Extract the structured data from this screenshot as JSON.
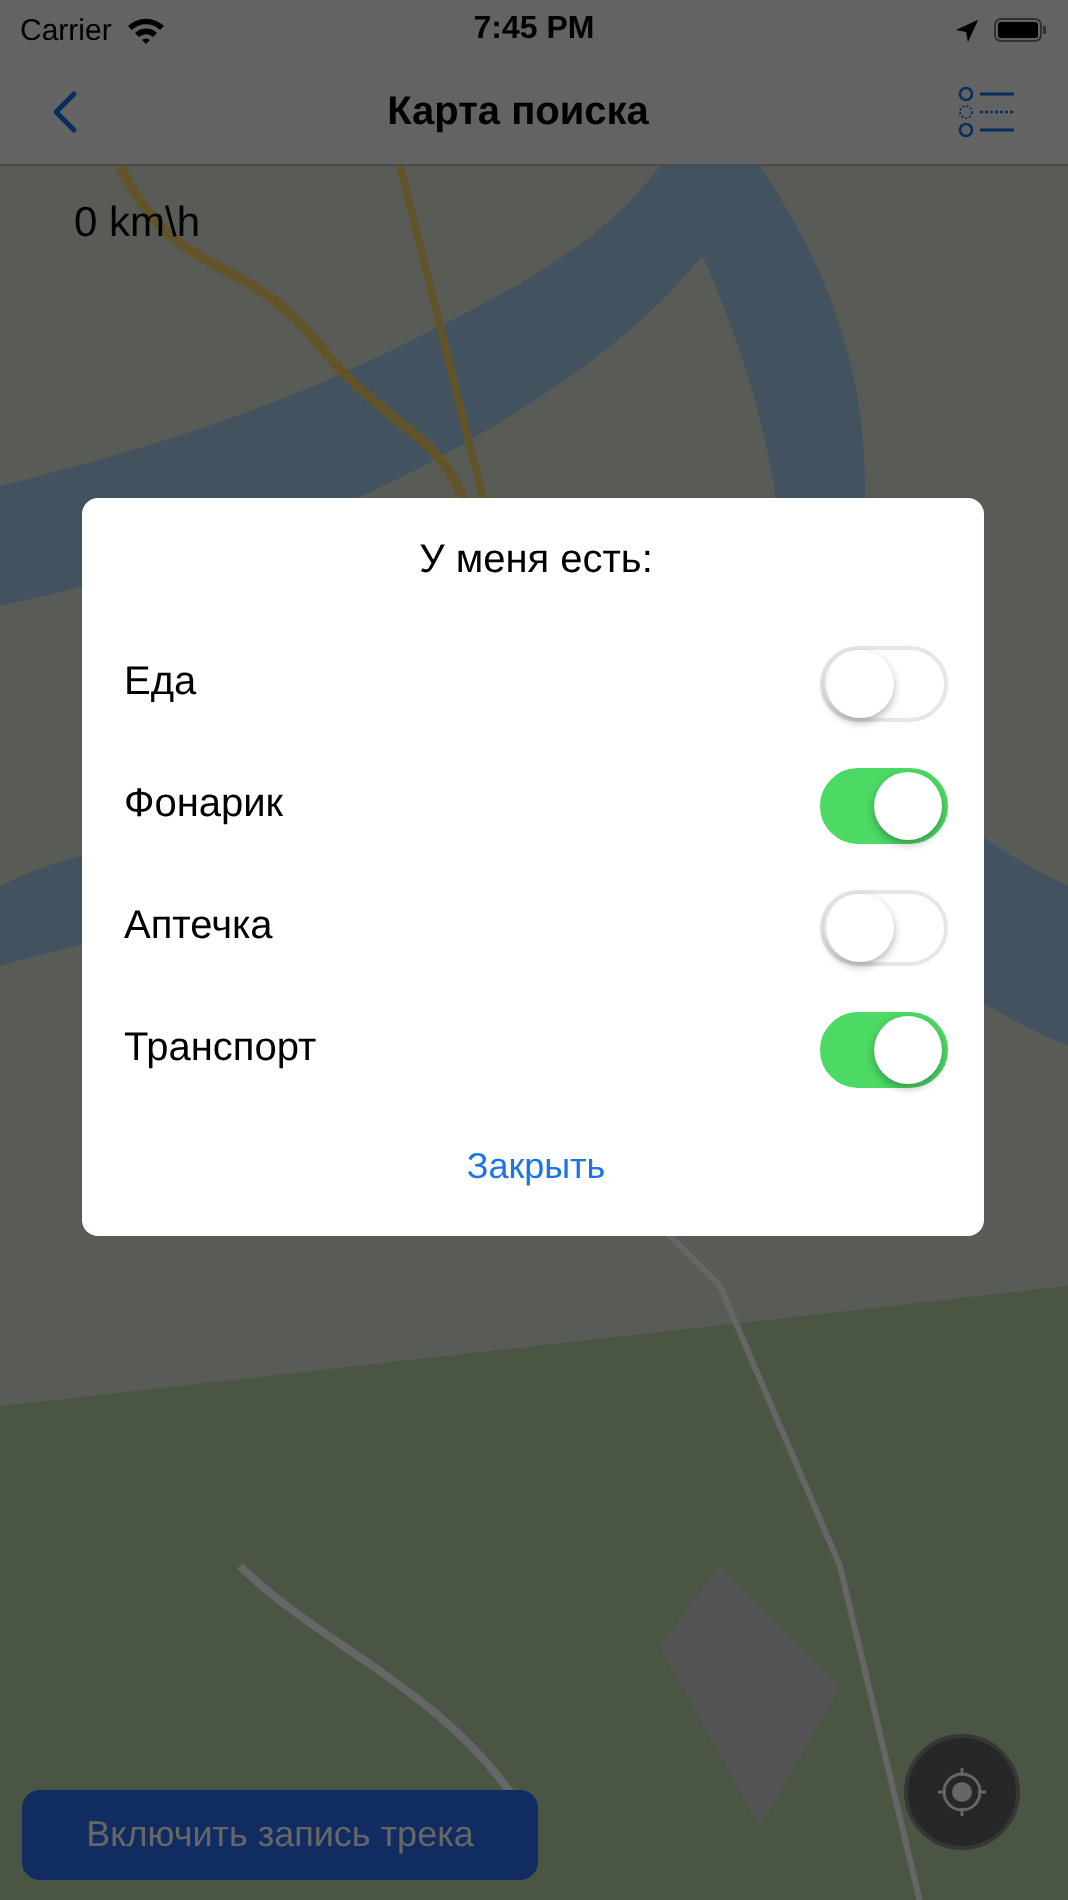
{
  "status_bar": {
    "carrier": "Carrier",
    "time": "7:45 PM"
  },
  "nav": {
    "title": "Карта поиска"
  },
  "speed": "0 km\\h",
  "dialog": {
    "title": "У меня есть:",
    "options": [
      {
        "label": "Еда",
        "on": false
      },
      {
        "label": "Фонарик",
        "on": true
      },
      {
        "label": "Аптечка",
        "on": false
      },
      {
        "label": "Транспорт",
        "on": true
      }
    ],
    "close": "Закрыть"
  },
  "track_button": "Включить запись трека"
}
